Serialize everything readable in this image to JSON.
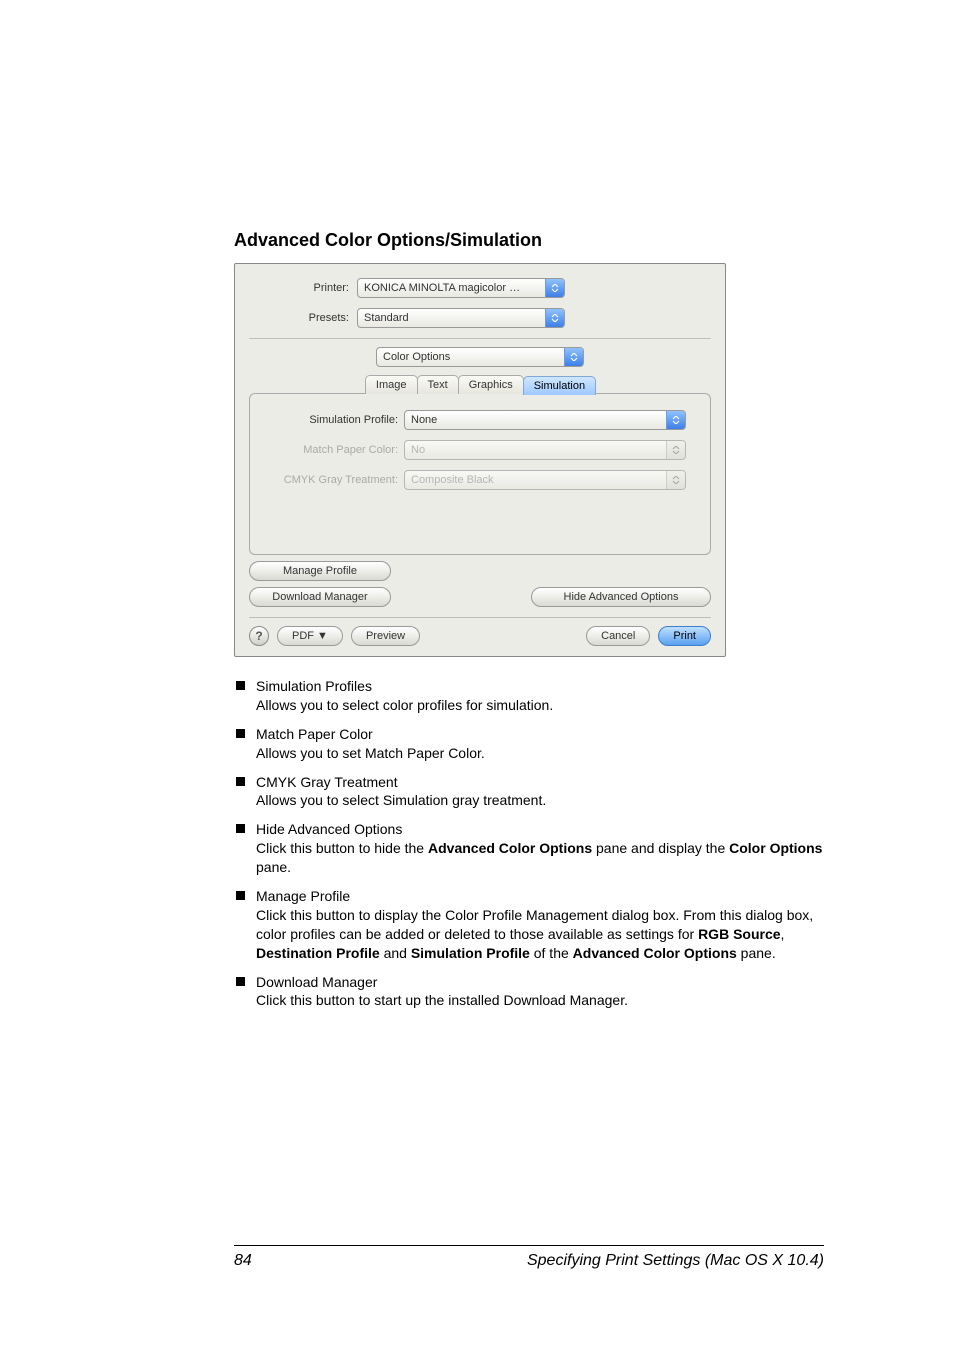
{
  "heading": "Advanced Color Options/Simulation",
  "dialog": {
    "printer_label": "Printer:",
    "printer_value": "KONICA MINOLTA magicolor …",
    "presets_label": "Presets:",
    "presets_value": "Standard",
    "pane_select": "Color Options",
    "tabs": {
      "image": "Image",
      "text": "Text",
      "graphics": "Graphics",
      "simulation": "Simulation"
    },
    "sim_profile_label": "Simulation Profile:",
    "sim_profile_value": "None",
    "match_paper_label": "Match Paper Color:",
    "match_paper_value": "No",
    "cmyk_gray_label": "CMYK Gray Treatment:",
    "cmyk_gray_value": "Composite Black",
    "manage_profile_btn": "Manage Profile",
    "download_manager_btn": "Download Manager",
    "hide_adv_btn": "Hide Advanced Options",
    "help": "?",
    "pdf_btn": "PDF ▼",
    "preview_btn": "Preview",
    "cancel_btn": "Cancel",
    "print_btn": "Print"
  },
  "bullets": [
    {
      "title": "Simulation Profiles",
      "desc": "Allows you to select color profiles for simulation."
    },
    {
      "title": "Match Paper Color",
      "desc": "Allows you to set Match Paper Color."
    },
    {
      "title": "CMYK Gray Treatment",
      "desc": "Allows you to select Simulation gray treatment."
    },
    {
      "title": "Hide Advanced Options",
      "desc_pre": "Click this button to hide the ",
      "bold1": "Advanced Color Options",
      "mid1": " pane and display the ",
      "bold2": "Color Options",
      "post": " pane."
    },
    {
      "title": "Manage Profile",
      "desc_pre": "Click this button to display the Color Profile Management dialog box. From this dialog box, color profiles can be added or deleted to those available as settings for ",
      "bold1": "RGB Source",
      "mid1": ", ",
      "bold2": "Destination Profile",
      "mid2": " and ",
      "bold3": "Simulation Profile",
      "mid3": " of the ",
      "bold4": "Advanced Color Options",
      "post": " pane."
    },
    {
      "title": "Download Manager",
      "desc": "Click this button to start up the installed Download Manager."
    }
  ],
  "footer": {
    "page": "84",
    "text": "Specifying Print Settings (Mac OS X 10.4)"
  }
}
